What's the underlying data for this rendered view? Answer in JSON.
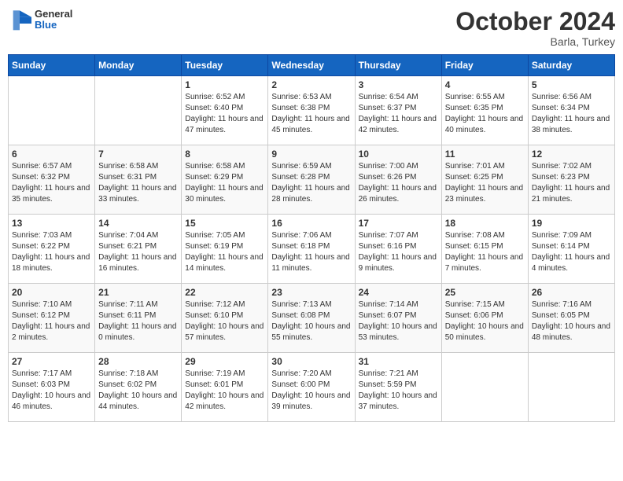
{
  "header": {
    "logo_general": "General",
    "logo_blue": "Blue",
    "title": "October 2024",
    "location": "Barla, Turkey"
  },
  "days_of_week": [
    "Sunday",
    "Monday",
    "Tuesday",
    "Wednesday",
    "Thursday",
    "Friday",
    "Saturday"
  ],
  "weeks": [
    [
      {
        "day": "",
        "info": ""
      },
      {
        "day": "",
        "info": ""
      },
      {
        "day": "1",
        "info": "Sunrise: 6:52 AM\nSunset: 6:40 PM\nDaylight: 11 hours and 47 minutes."
      },
      {
        "day": "2",
        "info": "Sunrise: 6:53 AM\nSunset: 6:38 PM\nDaylight: 11 hours and 45 minutes."
      },
      {
        "day": "3",
        "info": "Sunrise: 6:54 AM\nSunset: 6:37 PM\nDaylight: 11 hours and 42 minutes."
      },
      {
        "day": "4",
        "info": "Sunrise: 6:55 AM\nSunset: 6:35 PM\nDaylight: 11 hours and 40 minutes."
      },
      {
        "day": "5",
        "info": "Sunrise: 6:56 AM\nSunset: 6:34 PM\nDaylight: 11 hours and 38 minutes."
      }
    ],
    [
      {
        "day": "6",
        "info": "Sunrise: 6:57 AM\nSunset: 6:32 PM\nDaylight: 11 hours and 35 minutes."
      },
      {
        "day": "7",
        "info": "Sunrise: 6:58 AM\nSunset: 6:31 PM\nDaylight: 11 hours and 33 minutes."
      },
      {
        "day": "8",
        "info": "Sunrise: 6:58 AM\nSunset: 6:29 PM\nDaylight: 11 hours and 30 minutes."
      },
      {
        "day": "9",
        "info": "Sunrise: 6:59 AM\nSunset: 6:28 PM\nDaylight: 11 hours and 28 minutes."
      },
      {
        "day": "10",
        "info": "Sunrise: 7:00 AM\nSunset: 6:26 PM\nDaylight: 11 hours and 26 minutes."
      },
      {
        "day": "11",
        "info": "Sunrise: 7:01 AM\nSunset: 6:25 PM\nDaylight: 11 hours and 23 minutes."
      },
      {
        "day": "12",
        "info": "Sunrise: 7:02 AM\nSunset: 6:23 PM\nDaylight: 11 hours and 21 minutes."
      }
    ],
    [
      {
        "day": "13",
        "info": "Sunrise: 7:03 AM\nSunset: 6:22 PM\nDaylight: 11 hours and 18 minutes."
      },
      {
        "day": "14",
        "info": "Sunrise: 7:04 AM\nSunset: 6:21 PM\nDaylight: 11 hours and 16 minutes."
      },
      {
        "day": "15",
        "info": "Sunrise: 7:05 AM\nSunset: 6:19 PM\nDaylight: 11 hours and 14 minutes."
      },
      {
        "day": "16",
        "info": "Sunrise: 7:06 AM\nSunset: 6:18 PM\nDaylight: 11 hours and 11 minutes."
      },
      {
        "day": "17",
        "info": "Sunrise: 7:07 AM\nSunset: 6:16 PM\nDaylight: 11 hours and 9 minutes."
      },
      {
        "day": "18",
        "info": "Sunrise: 7:08 AM\nSunset: 6:15 PM\nDaylight: 11 hours and 7 minutes."
      },
      {
        "day": "19",
        "info": "Sunrise: 7:09 AM\nSunset: 6:14 PM\nDaylight: 11 hours and 4 minutes."
      }
    ],
    [
      {
        "day": "20",
        "info": "Sunrise: 7:10 AM\nSunset: 6:12 PM\nDaylight: 11 hours and 2 minutes."
      },
      {
        "day": "21",
        "info": "Sunrise: 7:11 AM\nSunset: 6:11 PM\nDaylight: 11 hours and 0 minutes."
      },
      {
        "day": "22",
        "info": "Sunrise: 7:12 AM\nSunset: 6:10 PM\nDaylight: 10 hours and 57 minutes."
      },
      {
        "day": "23",
        "info": "Sunrise: 7:13 AM\nSunset: 6:08 PM\nDaylight: 10 hours and 55 minutes."
      },
      {
        "day": "24",
        "info": "Sunrise: 7:14 AM\nSunset: 6:07 PM\nDaylight: 10 hours and 53 minutes."
      },
      {
        "day": "25",
        "info": "Sunrise: 7:15 AM\nSunset: 6:06 PM\nDaylight: 10 hours and 50 minutes."
      },
      {
        "day": "26",
        "info": "Sunrise: 7:16 AM\nSunset: 6:05 PM\nDaylight: 10 hours and 48 minutes."
      }
    ],
    [
      {
        "day": "27",
        "info": "Sunrise: 7:17 AM\nSunset: 6:03 PM\nDaylight: 10 hours and 46 minutes."
      },
      {
        "day": "28",
        "info": "Sunrise: 7:18 AM\nSunset: 6:02 PM\nDaylight: 10 hours and 44 minutes."
      },
      {
        "day": "29",
        "info": "Sunrise: 7:19 AM\nSunset: 6:01 PM\nDaylight: 10 hours and 42 minutes."
      },
      {
        "day": "30",
        "info": "Sunrise: 7:20 AM\nSunset: 6:00 PM\nDaylight: 10 hours and 39 minutes."
      },
      {
        "day": "31",
        "info": "Sunrise: 7:21 AM\nSunset: 5:59 PM\nDaylight: 10 hours and 37 minutes."
      },
      {
        "day": "",
        "info": ""
      },
      {
        "day": "",
        "info": ""
      }
    ]
  ]
}
